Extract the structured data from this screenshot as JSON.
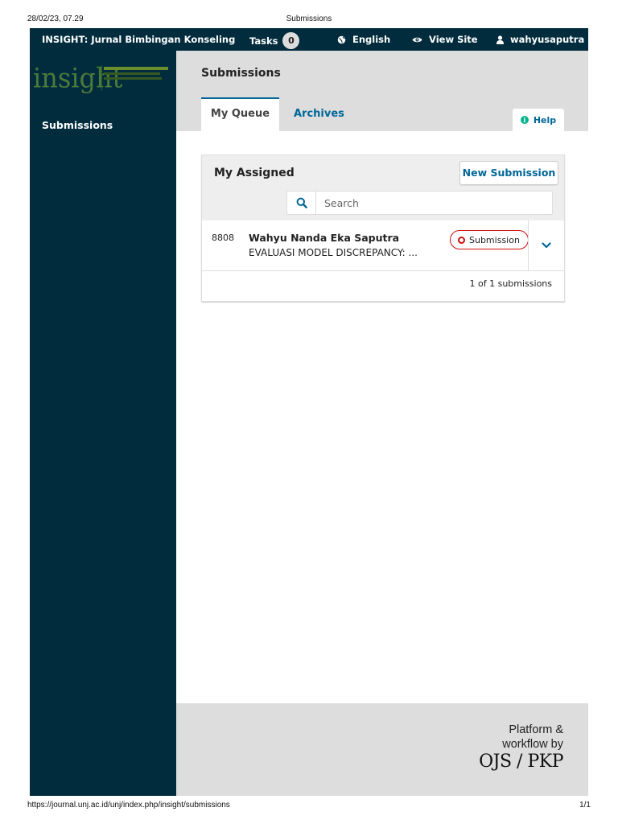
{
  "print": {
    "timestamp": "28/02/23, 07.29",
    "page_title": "Submissions",
    "url": "https://journal.unj.ac.id/unj/index.php/insight/submissions",
    "page_number": "1/1"
  },
  "topbar": {
    "site_name": "INSIGHT: Jurnal Bimbingan Konseling",
    "tasks_label": "Tasks",
    "tasks_count": "0",
    "language": "English",
    "view_site": "View Site",
    "username": "wahyusaputra"
  },
  "logo": {
    "word": "insight"
  },
  "sidebar": {
    "items": [
      {
        "label": "Submissions"
      }
    ]
  },
  "main": {
    "title": "Submissions",
    "tabs": [
      {
        "label": "My Queue",
        "active": true
      },
      {
        "label": "Archives",
        "active": false
      }
    ],
    "help_label": "Help",
    "panel": {
      "title": "My Assigned",
      "new_submission_label": "New Submission",
      "search_placeholder": "Search",
      "submissions": [
        {
          "id": "8808",
          "author": "Wahyu Nanda Eka Saputra",
          "title": "EVALUASI MODEL DISCREPANCY: ...",
          "stage": "Submission"
        }
      ],
      "count_text": "1 of 1 submissions"
    }
  },
  "footer": {
    "platform_line1": "Platform &",
    "platform_line2": "workflow by",
    "brand": "OJS / PKP"
  },
  "colors": {
    "topbar_bg": "#002c3e",
    "link": "#006798",
    "badge_border": "#d00a0a",
    "help_icon": "#00b28d",
    "subhead_bg": "#dddddd"
  }
}
